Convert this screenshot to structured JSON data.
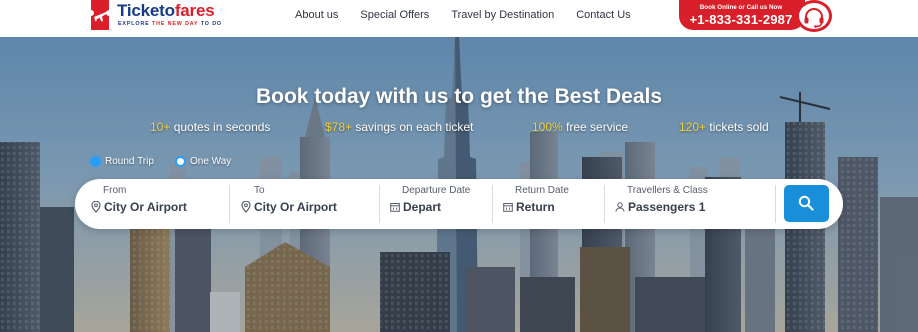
{
  "brand": {
    "name_part1": "Ticketo",
    "name_part2": "fares",
    "tagline_part1": "EXPLORE ",
    "tagline_part2": "THE NEW DAY",
    "tagline_part3": " TO DO",
    "primary_color": "#173a86",
    "accent_color": "#d9202a",
    "logo_icon": "airplane-ticket-icon"
  },
  "nav": {
    "items": [
      {
        "label": "About us"
      },
      {
        "label": "Special Offers"
      },
      {
        "label": "Travel by Destination"
      },
      {
        "label": "Contact Us"
      }
    ]
  },
  "contact": {
    "caption": "Book Online or Call us Now",
    "phone": "+1-833-331-2987",
    "icon": "headset-icon",
    "color": "#d9202a"
  },
  "hero": {
    "headline": "Book today with us to get the Best Deals",
    "stats": [
      {
        "highlight": "10+",
        "text": " quotes in seconds"
      },
      {
        "highlight": "$78+",
        "text": " savings on each ticket"
      },
      {
        "highlight": "100%",
        "text": " free service"
      },
      {
        "highlight": "120+",
        "text": " tickets sold"
      }
    ],
    "highlight_color": "#f4d03f",
    "background": "city-skyline-photo"
  },
  "trip_type": {
    "options": [
      {
        "label": "Round Trip",
        "selected": true
      },
      {
        "label": "One Way",
        "selected": false
      }
    ]
  },
  "search_form": {
    "fields": {
      "from": {
        "label": "From",
        "value": "City Or Airport",
        "icon": "location-pin-icon"
      },
      "to": {
        "label": "To",
        "value": "City Or Airport",
        "icon": "location-pin-icon"
      },
      "departure": {
        "label": "Departure Date",
        "value": "Depart",
        "icon": "calendar-icon"
      },
      "return": {
        "label": "Return Date",
        "value": "Return",
        "icon": "calendar-icon"
      },
      "travellers": {
        "label": "Travellers & Class",
        "value": "Passengers 1",
        "icon": "person-icon"
      }
    },
    "search_icon": "search-icon",
    "button_color": "#1a8fd9"
  }
}
